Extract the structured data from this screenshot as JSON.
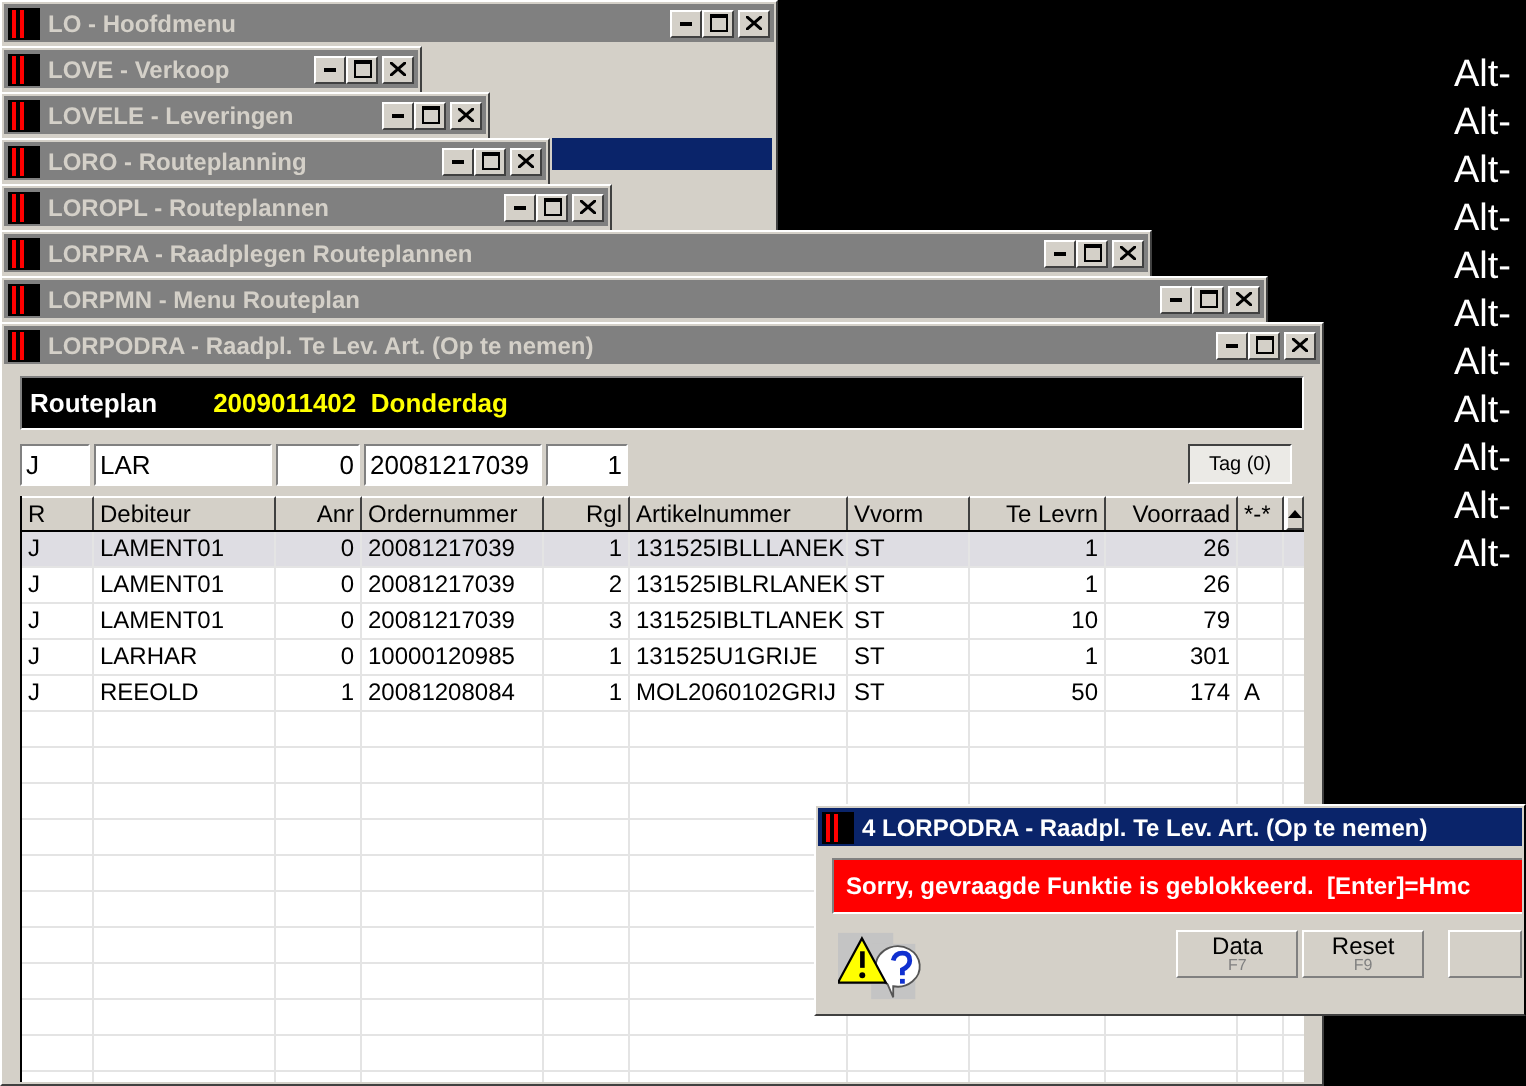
{
  "desktop_labels": [
    "Alt-",
    "Alt-",
    "Alt-",
    "Alt-",
    "Alt-",
    "Alt-",
    "Alt-",
    "Alt-",
    "Alt-",
    "Alt-",
    "Alt-"
  ],
  "background_windows": [
    {
      "title": "LO - Hoofdmenu",
      "active": false
    },
    {
      "title": "LOVE - Verkoop",
      "active": false
    },
    {
      "title": "LOVELE - Leveringen",
      "active": false
    },
    {
      "title": "LORO - Routeplanning",
      "active": false
    },
    {
      "title": "LOROPL - Routeplannen",
      "active": false
    },
    {
      "title": "LORPRA - Raadplegen Routeplannen",
      "active": false
    },
    {
      "title": "LORPMN - Menu Routeplan",
      "active": false
    }
  ],
  "main_window": {
    "title": "LORPODRA - Raadpl. Te Lev. Art. (Op te nemen)",
    "active": false,
    "header": {
      "label": "Routeplan",
      "value": "2009011402  Donderdag"
    },
    "filters": [
      "J",
      "LAR",
      "0",
      "20081217039",
      "1"
    ],
    "tag_button": "Tag (0)",
    "table": {
      "columns": [
        "R",
        "Debiteur",
        "Anr",
        "Ordernummer",
        "Rgl",
        "Artikelnummer",
        "Vvorm",
        "Te Levrn",
        "Voorraad",
        "*-*"
      ],
      "rows": [
        {
          "selected": true,
          "cells": [
            "J",
            "LAMENT01",
            "0",
            "20081217039",
            "1",
            "131525IBLLLANEK",
            "ST",
            "1",
            "26",
            ""
          ]
        },
        {
          "selected": false,
          "cells": [
            "J",
            "LAMENT01",
            "0",
            "20081217039",
            "2",
            "131525IBLRLANEK",
            "ST",
            "1",
            "26",
            ""
          ]
        },
        {
          "selected": false,
          "cells": [
            "J",
            "LAMENT01",
            "0",
            "20081217039",
            "3",
            "131525IBLTLANEK",
            "ST",
            "10",
            "79",
            ""
          ]
        },
        {
          "selected": false,
          "cells": [
            "J",
            "LARHAR",
            "0",
            "10000120985",
            "1",
            "131525U1GRIJE",
            "ST",
            "1",
            "301",
            ""
          ]
        },
        {
          "selected": false,
          "cells": [
            "J",
            "REEOLD",
            "1",
            "20081208084",
            "1",
            "MOL2060102GRIJ",
            "ST",
            "50",
            "174",
            "A"
          ]
        }
      ]
    }
  },
  "dialog": {
    "title": "4 LORPODRA - Raadpl. Te Lev. Art. (Op te nemen)",
    "active": true,
    "message": "Sorry, gevraagde Funktie is geblokkeerd.  [Enter]=Hmc",
    "buttons": [
      {
        "label": "Data",
        "key": "F7"
      },
      {
        "label": "Reset",
        "key": "F9"
      }
    ]
  }
}
